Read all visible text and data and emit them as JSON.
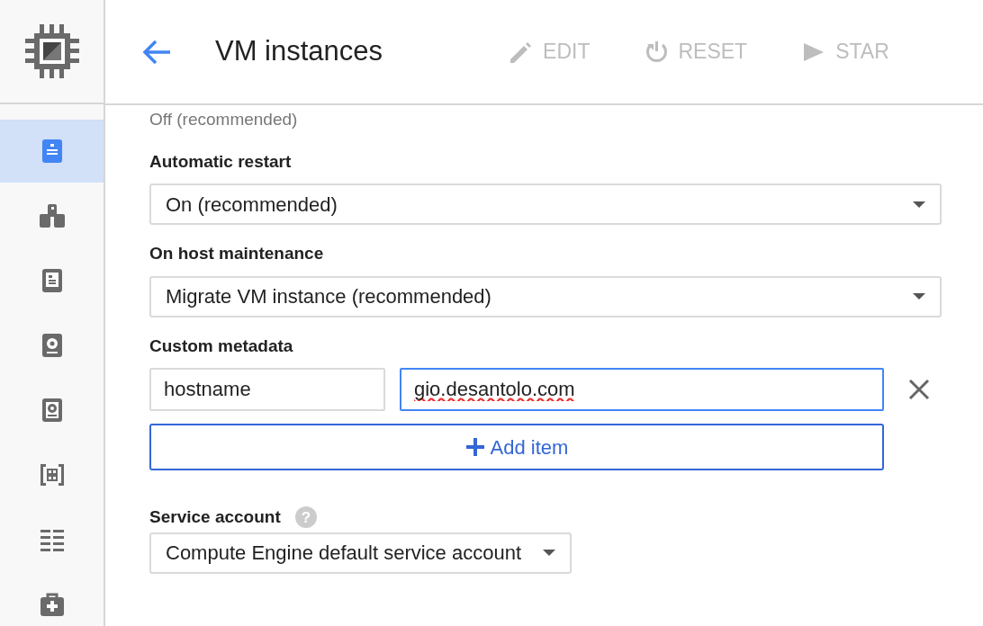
{
  "sidebar": {
    "items": [
      {
        "kind": "instances",
        "selected": true
      },
      {
        "kind": "groups",
        "selected": false
      },
      {
        "kind": "templates",
        "selected": false
      },
      {
        "kind": "disk",
        "selected": false
      },
      {
        "kind": "snapshot",
        "selected": false
      },
      {
        "kind": "images",
        "selected": false
      },
      {
        "kind": "list",
        "selected": false
      },
      {
        "kind": "health",
        "selected": false
      }
    ]
  },
  "header": {
    "title": "VM instances",
    "actions": [
      {
        "kind": "edit",
        "label": "EDIT",
        "disabled": true
      },
      {
        "kind": "reset",
        "label": "RESET",
        "disabled": true
      },
      {
        "kind": "start",
        "label": "STAR",
        "disabled": true
      }
    ]
  },
  "form": {
    "partial_text": "Off (recommended)",
    "automatic_restart": {
      "label": "Automatic restart",
      "value": "On (recommended)"
    },
    "on_host_maintenance": {
      "label": "On host maintenance",
      "value": "Migrate VM instance (recommended)"
    },
    "custom_metadata": {
      "label": "Custom metadata",
      "items": [
        {
          "key": "hostname",
          "value": "gio.desantolo.com"
        }
      ],
      "add_button": "Add item"
    },
    "service_account": {
      "label": "Service account",
      "value": "Compute Engine default service account",
      "help": "?"
    }
  }
}
